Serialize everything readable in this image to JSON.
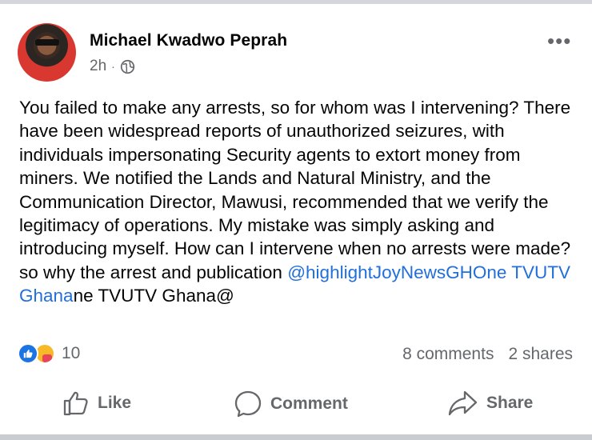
{
  "post": {
    "author": "Michael Kwadwo Peprah",
    "time": "2h",
    "separator": "·",
    "privacy_icon": "globe-icon",
    "more_label": "•••",
    "text_before": "You failed to make any arrests, so for whom was I intervening? There have been widespread reports of unauthorized seizures, with individuals impersonating Security agents to extort money from miners. We notified the Lands and Natural Ministry, and the Communication Director, Mawusi, recommended that we verify the legitimacy of operations. My mistake was simply asking and introducing myself. How can I intervene when no arrests were made?so why the arrest and publication ",
    "mention": "@highlightJoyNewsGHOne TVUTV Ghana",
    "text_after": "ne TVUTV Ghana@"
  },
  "engagement": {
    "reaction_icons": [
      "like-reaction-icon",
      "care-reaction-icon"
    ],
    "reaction_count": "10",
    "comments": "8 comments",
    "shares": "2 shares"
  },
  "actions": {
    "like": "Like",
    "comment": "Comment",
    "share": "Share"
  },
  "colors": {
    "link": "#216fdb",
    "secondary_text": "#65676b",
    "like_blue": "#1b74e4"
  }
}
